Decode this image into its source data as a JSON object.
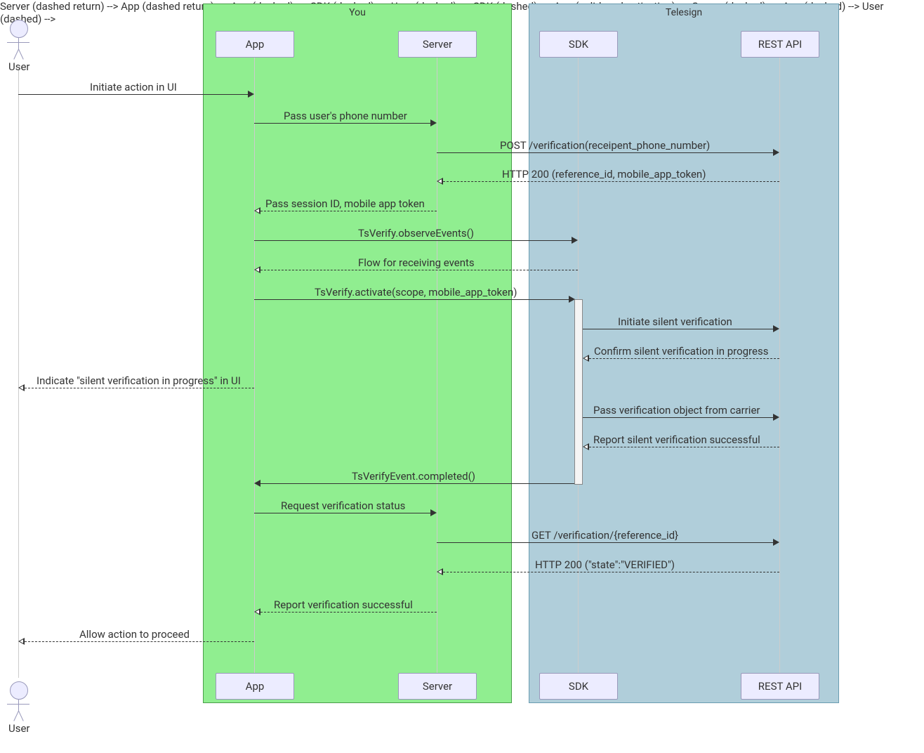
{
  "groups": {
    "you": {
      "title": "You"
    },
    "telesign": {
      "title": "Telesign"
    }
  },
  "actors": {
    "user": {
      "label": "User"
    }
  },
  "participants": {
    "app": {
      "label": "App"
    },
    "server": {
      "label": "Server"
    },
    "sdk": {
      "label": "SDK"
    },
    "rest": {
      "label": "REST API"
    }
  },
  "messages": [
    {
      "key": "m1",
      "text": "Initiate action in UI"
    },
    {
      "key": "m2",
      "text": "Pass user's phone number"
    },
    {
      "key": "m3",
      "text": "POST /verification(receipent_phone_number)"
    },
    {
      "key": "m4",
      "text": "HTTP 200 (reference_id, mobile_app_token)"
    },
    {
      "key": "m5",
      "text": "Pass session ID, mobile app token"
    },
    {
      "key": "m6",
      "text": "TsVerify.observeEvents()"
    },
    {
      "key": "m7",
      "text": "Flow for receiving events"
    },
    {
      "key": "m8",
      "text": "TsVerify.activate(scope, mobile_app_token)"
    },
    {
      "key": "m9",
      "text": "Initiate silent verification"
    },
    {
      "key": "m10",
      "text": "Confirm silent verification in progress"
    },
    {
      "key": "m11",
      "text": "Indicate \"silent verification\" in progress\" in UI"
    },
    {
      "key": "m12",
      "text": "Pass verification object from carrier"
    },
    {
      "key": "m13",
      "text": "Report silent verification successful"
    },
    {
      "key": "m14",
      "text": "TsVerifyEvent.completed()"
    },
    {
      "key": "m15",
      "text": "Request verification status"
    },
    {
      "key": "m16",
      "text": "GET /verification/{reference_id}"
    },
    {
      "key": "m17",
      "text": "HTTP 200 (\"state\":\"VERIFIED\")"
    },
    {
      "key": "m18",
      "text": "Report verification successful"
    },
    {
      "key": "m19",
      "text": "Allow action to proceed"
    }
  ],
  "message_overrides": {
    "m11": "Indicate \"silent verification in progress\" in UI"
  }
}
